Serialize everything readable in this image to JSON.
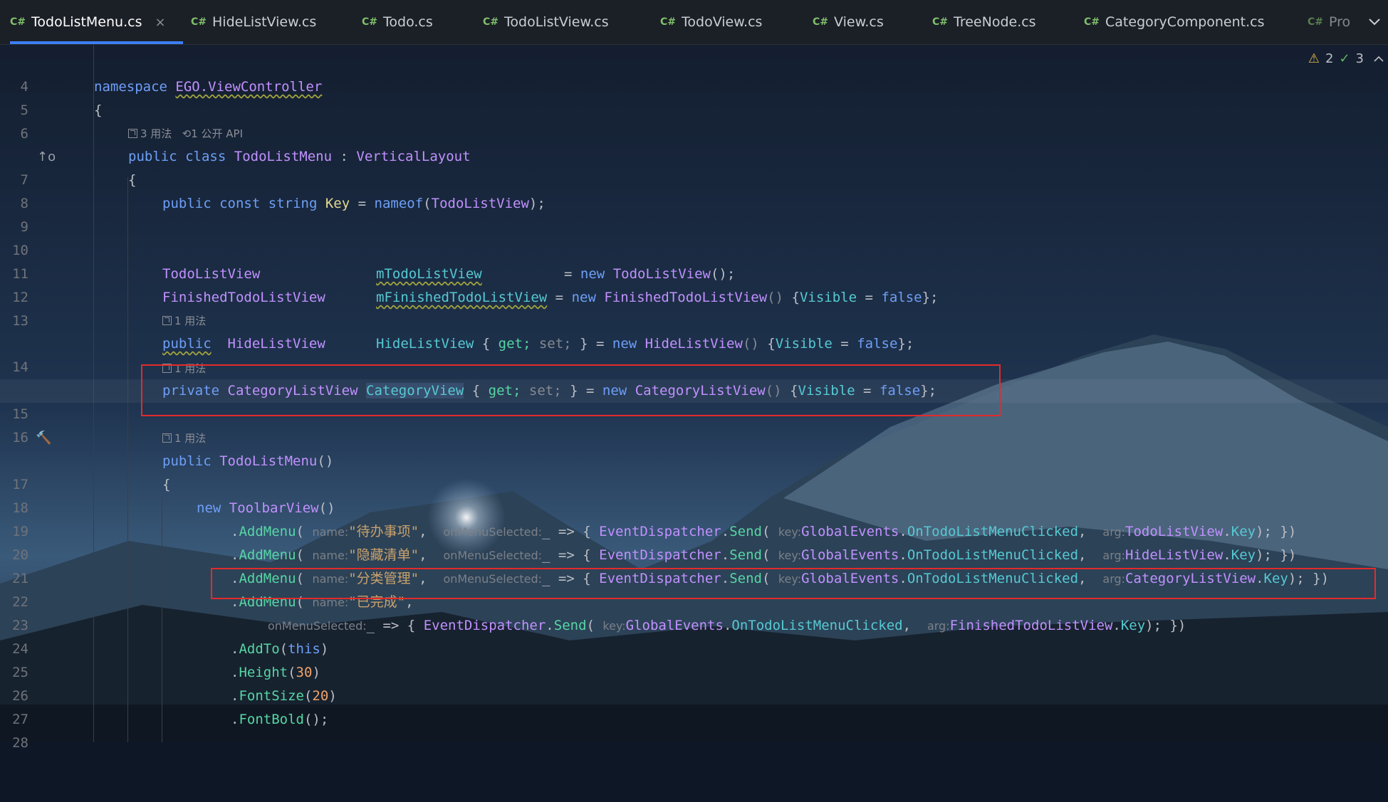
{
  "tabs": [
    {
      "icon": "C#",
      "label": "TodoListMenu.cs",
      "active": true,
      "close": "×"
    },
    {
      "icon": "C#",
      "label": "HideListView.cs"
    },
    {
      "icon": "C#",
      "label": "Todo.cs"
    },
    {
      "icon": "C#",
      "label": "TodoListView.cs"
    },
    {
      "icon": "C#",
      "label": "TodoView.cs"
    },
    {
      "icon": "C#",
      "label": "View.cs"
    },
    {
      "icon": "C#",
      "label": "TreeNode.cs"
    },
    {
      "icon": "C#",
      "label": "CategoryComponent.cs"
    },
    {
      "icon": "C#",
      "label": "Pro"
    }
  ],
  "tab_overflow_icon": "chevron-down-icon",
  "inspections": {
    "warnings": "2",
    "ok": "3"
  },
  "hints": {
    "usages3": "3 用法",
    "public_api": "1 公开 API",
    "usage1": "1 用法"
  },
  "code": {
    "l4": "4",
    "l5": "5",
    "l6": "6",
    "l7": "7",
    "l8": "8",
    "l9": "9",
    "l10": "10",
    "l11": "11",
    "l12": "12",
    "l13": "13",
    "l14": "14",
    "l15": "15",
    "l16": "16",
    "l17": "17",
    "l18": "18",
    "l19": "19",
    "l20": "20",
    "l21": "21",
    "l22": "22",
    "l23": "23",
    "l24": "24",
    "l25": "25",
    "l26": "26",
    "l27": "27",
    "l28": "28",
    "namespace_kw": "namespace",
    "namespace_name": "EGO.ViewController",
    "brace_open": "{",
    "public": "public",
    "class": "class",
    "private": "private",
    "const": "const",
    "string": "string",
    "new": "new",
    "get": "get;",
    "set": "set;",
    "false": "false",
    "this": "this",
    "class_name": "TodoListMenu",
    "base": "VerticalLayout",
    "key": "Key",
    "nameof": "nameof",
    "todolistview": "TodoListView",
    "finishedtodolistview": "FinishedTodoListView",
    "mtodolistview": "mTodoListView",
    "mfinishedtodolistview": "mFinishedTodoListView",
    "hidelistview": "HideListView",
    "categorylistview": "CategoryListView",
    "categoryview": "CategoryView",
    "visible": "Visible",
    "todolistmenu_ctor": "TodoListMenu",
    "toolbarview": "ToolbarView",
    "addmenu": "AddMenu",
    "name_param": "name:",
    "onmenuselected": "onMenuSelected:",
    "key_param": "key:",
    "arg_param": "arg:",
    "eventdispatcher": "EventDispatcher",
    "send": "Send",
    "globalevents": "GlobalEvents",
    "onclicked": "OnTodoListMenuClicked",
    "str1": "\"待办事项\"",
    "str2": "\"隐藏清单\"",
    "str3": "\"分类管理\"",
    "str4": "\"已完成\"",
    "addto": "AddTo",
    "height": "Height",
    "fontsize": "FontSize",
    "fontbold": "FontBold",
    "n30": "30",
    "n20": "20"
  }
}
